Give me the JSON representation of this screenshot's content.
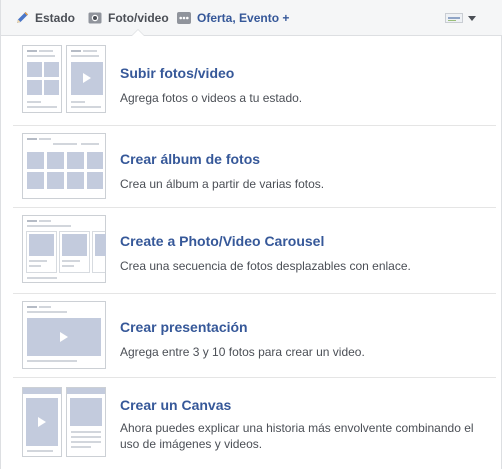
{
  "tabs": {
    "estado_label": "Estado",
    "foto_label": "Foto/video",
    "oferta_label": "Oferta, Evento +"
  },
  "options": [
    {
      "title": "Subir fotos/video",
      "description": "Agrega fotos o videos a tu estado."
    },
    {
      "title": "Crear álbum de fotos",
      "description": "Crea un álbum a partir de varias fotos."
    },
    {
      "title": "Create a Photo/Video Carousel",
      "description": "Crea una secuencia de fotos desplazables con enlace."
    },
    {
      "title": "Crear presentación",
      "description": "Agrega entre 3 y 10 fotos para crear un video."
    },
    {
      "title": "Crear un Canvas",
      "description": "Ahora puedes explicar una historia más envolvente combinando el uso de imágenes y videos."
    }
  ],
  "colors": {
    "link_blue": "#365899",
    "text_gray": "#4b4f56",
    "placeholder_blue": "#c3cbdd",
    "tabbar_bg": "#f5f6f7"
  },
  "icons": {
    "estado": "pencil-icon",
    "foto": "camera-icon",
    "oferta": "more-dots-icon",
    "audience": "audience-selector-icon"
  }
}
